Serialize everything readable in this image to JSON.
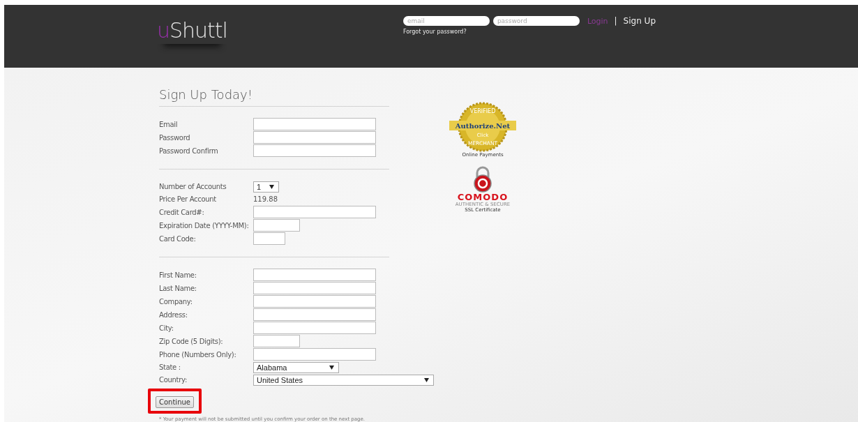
{
  "header": {
    "logo": {
      "accent": "u",
      "text": "Shuttl"
    },
    "email_field": {
      "placeholder": "email"
    },
    "password_field": {
      "placeholder": "password"
    },
    "login": "Login",
    "separator": "|",
    "signup": "Sign Up",
    "forgot": "Forgot your password?"
  },
  "title": "Sign Up Today!",
  "sections": [
    {
      "rows": [
        {
          "label": "Email",
          "kind": "text"
        },
        {
          "label": "Password",
          "kind": "text"
        },
        {
          "label": "Password Confirm",
          "kind": "text"
        }
      ]
    },
    {
      "rows": [
        {
          "label": "Number of Accounts",
          "kind": "tinyselect",
          "value": "1"
        },
        {
          "label": "Price Per Account",
          "kind": "value",
          "value": "119.88"
        },
        {
          "label": "Credit Card#:",
          "kind": "text"
        },
        {
          "label": "Expiration Date (YYYY-MM):",
          "kind": "short"
        },
        {
          "label": "Card Code:",
          "kind": "tiny"
        }
      ]
    },
    {
      "rows": [
        {
          "label": "First Name:",
          "kind": "text"
        },
        {
          "label": "Last Name:",
          "kind": "text"
        },
        {
          "label": "Company:",
          "kind": "text"
        },
        {
          "label": "Address:",
          "kind": "text"
        },
        {
          "label": "City:",
          "kind": "text"
        },
        {
          "label": "Zip Code (5 Digits):",
          "kind": "short"
        },
        {
          "label": "Phone (Numbers Only):",
          "kind": "text"
        },
        {
          "label": "State :",
          "kind": "select",
          "value": "Alabama"
        },
        {
          "label": "Country:",
          "kind": "wideselect",
          "value": "United States"
        }
      ]
    }
  ],
  "continue": "Continue",
  "highlight_continue": true,
  "footnote": "* Your payment will not be submitted until you confirm your order on the next page.",
  "authorize_seal": {
    "top": "VERIFIED",
    "name": "Authorize.Net",
    "click": "Click",
    "bottom": "MERCHANT",
    "caption": "Online Payments"
  },
  "comodo_seal": {
    "name": "COMODO",
    "tagline": "AUTHENTIC & SECURE",
    "caption": "SSL Certificate"
  }
}
